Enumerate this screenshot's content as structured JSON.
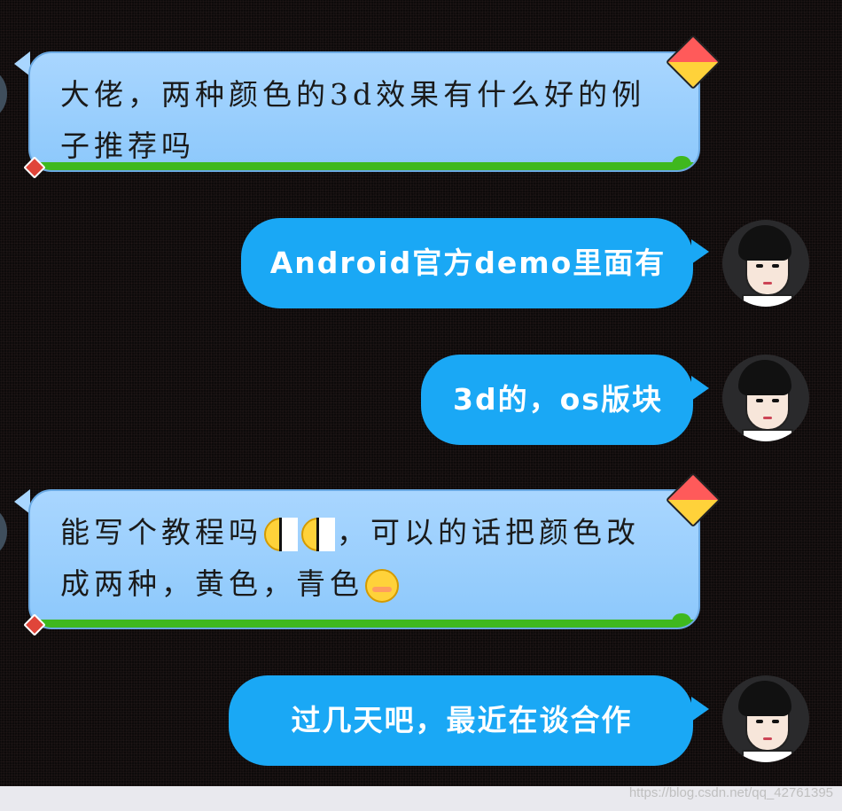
{
  "messages": [
    {
      "direction": "incoming",
      "text": "大佬，两种颜色的3d效果有什么好的例子推荐吗",
      "bubble_theme": "kite-sky"
    },
    {
      "direction": "outgoing",
      "text": "Android官方demo里面有"
    },
    {
      "direction": "outgoing",
      "text": "3d的，os版块"
    },
    {
      "direction": "incoming",
      "text_before_emoji": "能写个教程吗",
      "emojis_1": [
        "smirk-half-face-emoji",
        "smirk-half-face-emoji"
      ],
      "text_after_emoji": "，可以的话把颜色改成两种，黄色，青色",
      "emoji_end": "blush-emoji",
      "bubble_theme": "kite-sky"
    },
    {
      "direction": "outgoing",
      "text": "过几天吧，最近在谈合作"
    }
  ],
  "watermark": "https://blog.csdn.net/qq_42761395",
  "colors": {
    "background": "#0d0a0a",
    "incoming_bubble": "#a9d6ff",
    "outgoing_bubble": "#1aa8f5",
    "grass": "#3fb81e"
  }
}
